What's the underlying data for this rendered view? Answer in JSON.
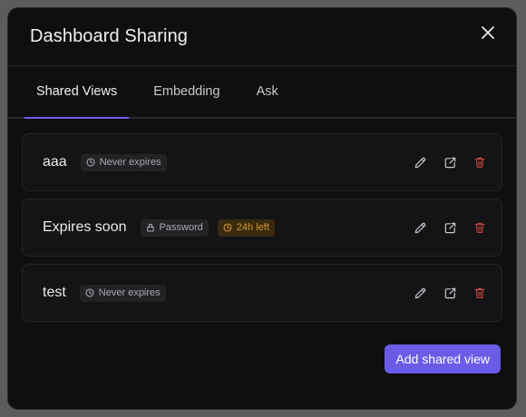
{
  "dialog": {
    "title": "Dashboard Sharing",
    "close_icon": "close-icon"
  },
  "tabs": [
    {
      "label": "Shared Views",
      "active": true
    },
    {
      "label": "Embedding",
      "active": false
    },
    {
      "label": "Ask",
      "active": false
    }
  ],
  "shared_views": [
    {
      "name": "aaa",
      "badges": [
        {
          "icon": "clock-icon",
          "label": "Never expires",
          "tone": "neutral"
        }
      ]
    },
    {
      "name": "Expires soon",
      "badges": [
        {
          "icon": "lock-icon",
          "label": "Password",
          "tone": "neutral"
        },
        {
          "icon": "clock-icon",
          "label": "24h left",
          "tone": "warning"
        }
      ]
    },
    {
      "name": "test",
      "badges": [
        {
          "icon": "clock-icon",
          "label": "Never expires",
          "tone": "neutral"
        }
      ]
    }
  ],
  "row_actions": [
    "pencil-icon",
    "external-link-icon",
    "trash-icon"
  ],
  "footer": {
    "add_button_label": "Add shared view"
  },
  "colors": {
    "accent": "#6b5ce8",
    "warning_text": "#d39a3a",
    "danger": "#c0453f"
  }
}
